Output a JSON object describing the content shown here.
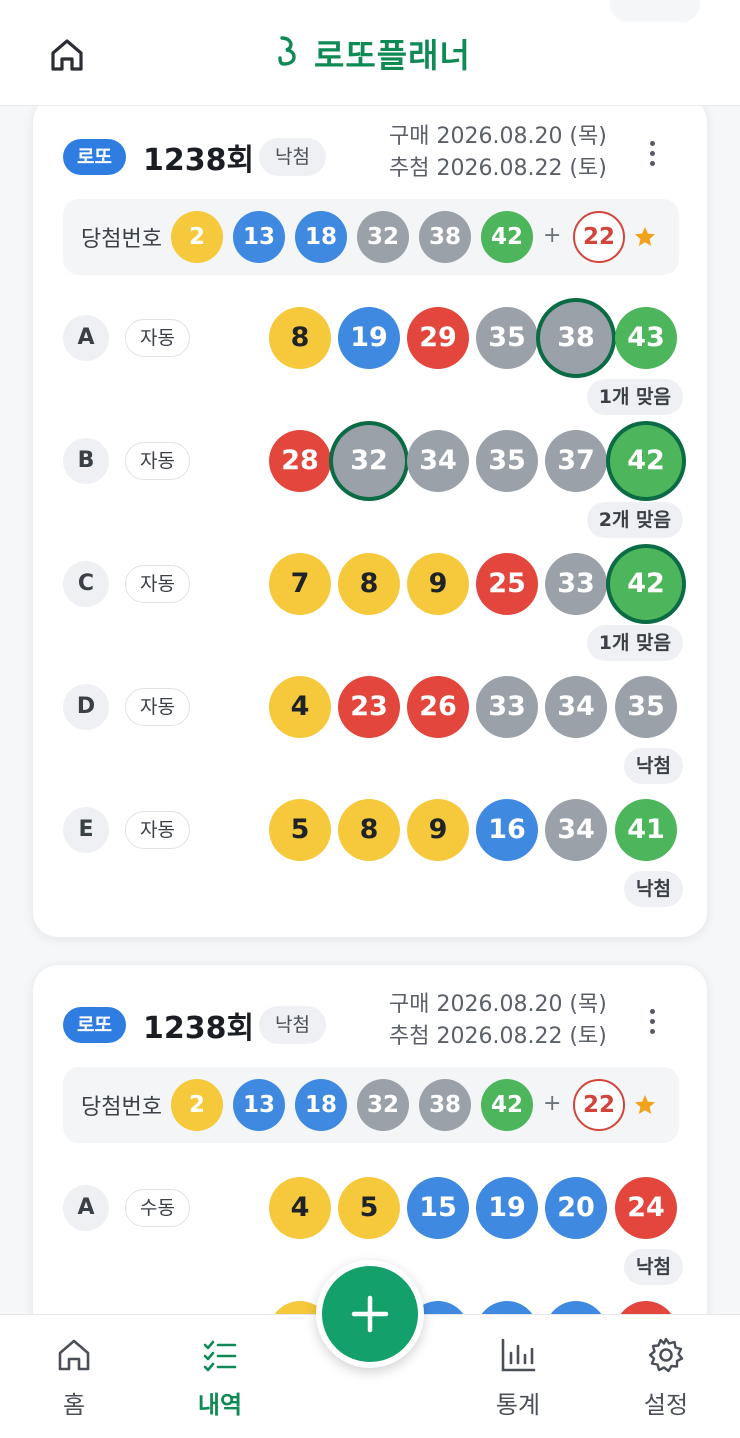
{
  "header": {
    "title": "로또플래너"
  },
  "cards": [
    {
      "badge": "로또",
      "round": "1238회",
      "status": "낙첨",
      "purchase": "구매 2026.08.20 (목)",
      "draw": "추첨 2026.08.22 (토)",
      "win_label": "당첨번호",
      "win_numbers": [
        "2",
        "13",
        "18",
        "32",
        "38",
        "42"
      ],
      "plus": "+",
      "bonus": "22",
      "rows": [
        {
          "letter": "A",
          "mode": "자동",
          "numbers": [
            "8",
            "19",
            "29",
            "35",
            "38",
            "43"
          ],
          "result": "1개 맞음"
        },
        {
          "letter": "B",
          "mode": "자동",
          "numbers": [
            "28",
            "32",
            "34",
            "35",
            "37",
            "42"
          ],
          "result": "2개 맞음"
        },
        {
          "letter": "C",
          "mode": "자동",
          "numbers": [
            "7",
            "8",
            "9",
            "25",
            "33",
            "42"
          ],
          "result": "1개 맞음"
        },
        {
          "letter": "D",
          "mode": "자동",
          "numbers": [
            "4",
            "23",
            "26",
            "33",
            "34",
            "35"
          ],
          "result": "낙첨"
        },
        {
          "letter": "E",
          "mode": "자동",
          "numbers": [
            "5",
            "8",
            "9",
            "16",
            "34",
            "41"
          ],
          "result": "낙첨"
        }
      ]
    },
    {
      "badge": "로또",
      "round": "1238회",
      "status": "낙첨",
      "purchase": "구매 2026.08.20 (목)",
      "draw": "추첨 2026.08.22 (토)",
      "win_label": "당첨번호",
      "win_numbers": [
        "2",
        "13",
        "18",
        "32",
        "38",
        "42"
      ],
      "plus": "+",
      "bonus": "22",
      "rows": [
        {
          "letter": "A",
          "mode": "수동",
          "numbers": [
            "4",
            "5",
            "15",
            "19",
            "20",
            "24"
          ],
          "result": "낙첨"
        }
      ]
    }
  ],
  "nav": {
    "home": "홈",
    "history": "내역",
    "stats": "통계",
    "settings": "설정"
  },
  "colors": {
    "brand": "#0f8a55",
    "yellow": "#f5c93b",
    "blue": "#3f8ae0",
    "red": "#e2463c",
    "gray": "#9ba1a9",
    "green": "#4db55c",
    "hit_ring": "#0b6b45"
  }
}
